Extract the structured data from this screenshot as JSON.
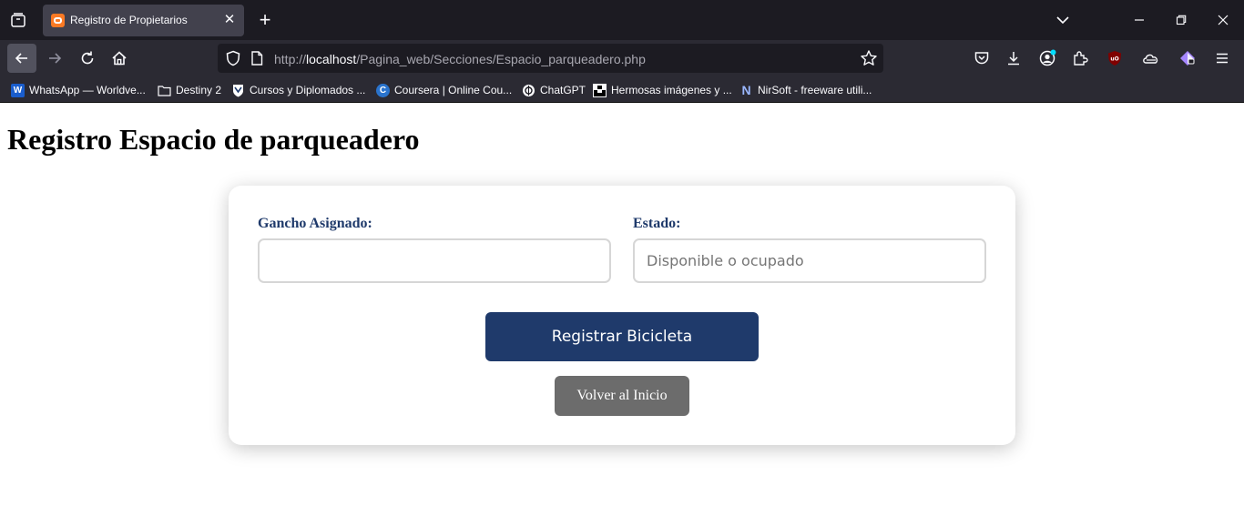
{
  "browser": {
    "tab": {
      "title": "Registro de Propietarios",
      "favicon": "xampp-icon"
    },
    "url": {
      "scheme": "http://",
      "host": "localhost",
      "path": "/Pagina_web/Secciones/Espacio_parqueadero.php"
    },
    "bookmarks": [
      {
        "label": "WhatsApp — Worldve...",
        "icon": "w-icon"
      },
      {
        "label": "Destiny 2",
        "icon": "folder-icon"
      },
      {
        "label": "Cursos y Diplomados ...",
        "icon": "shield-icon"
      },
      {
        "label": "Coursera | Online Cou...",
        "icon": "coursera-icon"
      },
      {
        "label": "ChatGPT",
        "icon": "chatgpt-icon"
      },
      {
        "label": "Hermosas imágenes y ...",
        "icon": "unsplash-icon"
      },
      {
        "label": "NirSoft - freeware utili...",
        "icon": "nirsoft-icon"
      }
    ],
    "colors": {
      "chrome_dark": "#1c1b22",
      "chrome": "#2b2a33",
      "tab_active": "#42414d"
    }
  },
  "page": {
    "title": "Registro Espacio de parqueadero",
    "form": {
      "gancho": {
        "label": "Gancho Asignado:",
        "value": "",
        "placeholder": ""
      },
      "estado": {
        "label": "Estado:",
        "value": "",
        "placeholder": "Disponible o ocupado"
      },
      "submit_label": "Registrar Bicicleta",
      "back_label": "Volver al Inicio"
    },
    "colors": {
      "primary": "#1f3a6b",
      "secondary": "#6c6c6c",
      "label": "#1f3a6b"
    }
  }
}
